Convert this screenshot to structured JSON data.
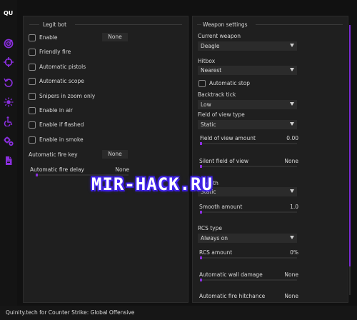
{
  "colors": {
    "accent": "#8b2fe0",
    "background": "#111111",
    "panel": "#1f1f1f"
  },
  "sidebar": {
    "logo": "QU",
    "icons": [
      "aimbot-icon",
      "crosshair-icon",
      "refresh-icon",
      "sun-icon",
      "wheelchair-icon",
      "gears-icon",
      "file-icon"
    ]
  },
  "legit": {
    "title": "Legit bot",
    "enable": "Enable",
    "enable_key": "None",
    "checkboxes": [
      "Friendly fire",
      "Automatic pistols",
      "Automatic scope",
      "Snipers in zoom only",
      "Enable in air",
      "Enable if flashed",
      "Enable in smoke"
    ],
    "fire_key_label": "Automatic fire key",
    "fire_key": "None",
    "fire_delay_label": "Automatic fire delay",
    "fire_delay": "None"
  },
  "weapon": {
    "title": "Weapon settings",
    "current_weapon_label": "Current weapon",
    "current_weapon": "Deagle",
    "hitbox_label": "Hitbox",
    "hitbox": "Nearest",
    "auto_stop": "Automatic stop",
    "backtrack_label": "Backtrack tick",
    "backtrack": "Low",
    "fov_label": "Field of view type",
    "fov_type": "Static",
    "fov_amount_label": "Field of view amount",
    "fov_amount": "0.00",
    "silent_fov_label": "Silent field of view",
    "silent_fov": "None",
    "smooth_label": "Smooth",
    "smooth_type": "Static",
    "smooth_amount_label": "Smooth amount",
    "smooth_amount": "1.0",
    "rcs_type_label": "RCS type",
    "rcs_type": "Always on",
    "rcs_amount_label": "RCS amount",
    "rcs_amount": "0%",
    "wall_damage_label": "Automatic wall damage",
    "wall_damage": "None",
    "hitchance_label": "Automatic fire hitchance",
    "hitchance": "None"
  },
  "footer": "Quinity.tech for Counter Strike: Global Offensive",
  "watermark": "MIR-HACK.RU"
}
